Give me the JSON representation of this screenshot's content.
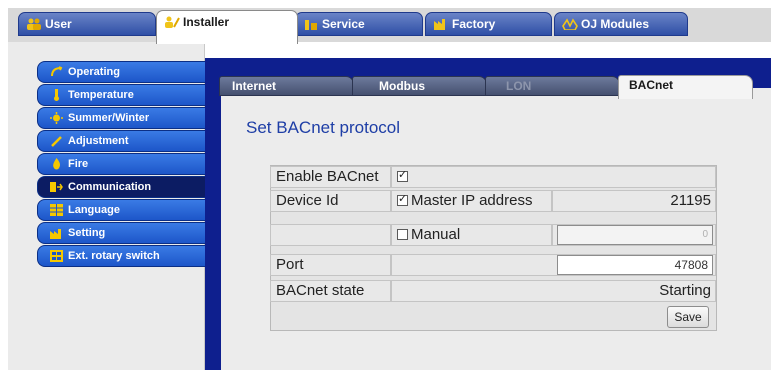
{
  "top_tabs": [
    {
      "label": "User",
      "icon": "users-icon"
    },
    {
      "label": "Installer",
      "icon": "installer-icon"
    },
    {
      "label": "Service",
      "icon": "service-icon"
    },
    {
      "label": "Factory",
      "icon": "factory-icon"
    },
    {
      "label": "OJ Modules",
      "icon": "modules-icon"
    }
  ],
  "sidebar": {
    "items": [
      {
        "label": "Operating",
        "icon": "operating-icon"
      },
      {
        "label": "Temperature",
        "icon": "thermometer-icon"
      },
      {
        "label": "Summer/Winter",
        "icon": "sun-icon"
      },
      {
        "label": "Adjustment",
        "icon": "adjustment-icon"
      },
      {
        "label": "Fire",
        "icon": "fire-icon"
      },
      {
        "label": "Communication",
        "icon": "communication-icon"
      },
      {
        "label": "Language",
        "icon": "language-icon"
      },
      {
        "label": "Setting",
        "icon": "setting-icon"
      },
      {
        "label": "Ext. rotary switch",
        "icon": "rotary-switch-icon"
      }
    ]
  },
  "sub_tabs": [
    {
      "label": "Internet"
    },
    {
      "label": "Modbus"
    },
    {
      "label": "LON"
    },
    {
      "label": "BACnet"
    }
  ],
  "section": {
    "title": "Set BACnet protocol"
  },
  "form": {
    "enable_label": "Enable BACnet",
    "device_id_label": "Device Id",
    "master_ip_label": "Master IP address",
    "master_ip_value": "21195",
    "manual_label": "Manual",
    "manual_value": "0",
    "port_label": "Port",
    "port_value": "47808",
    "state_label": "BACnet state",
    "state_value": "Starting",
    "save_label": "Save"
  },
  "check": "✓",
  "colors": {
    "tab_blue": "#2f4fa6",
    "nav_blue": "#1d56c9",
    "nav_active": "#0c1c63",
    "panel_blue": "#0e1f8e",
    "title_blue": "#1e3ea6"
  }
}
